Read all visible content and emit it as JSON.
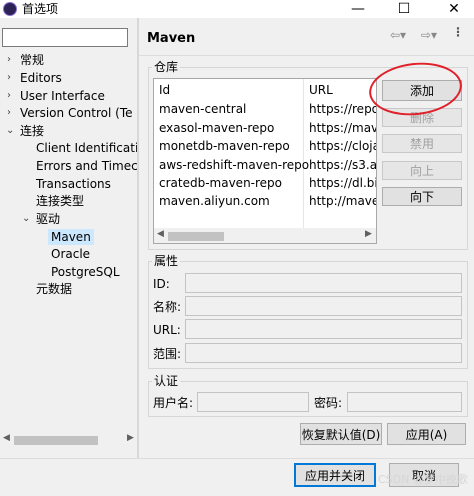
{
  "window": {
    "title": "首选项",
    "controls": {
      "minimize": "—",
      "maximize": "☐",
      "close": "✕"
    }
  },
  "sidebar": {
    "filter_value": "",
    "items": [
      {
        "label": "常规"
      },
      {
        "label": "Editors"
      },
      {
        "label": "User Interface"
      },
      {
        "label": "Version Control (Te"
      },
      {
        "label": "连接"
      },
      {
        "label": "Client Identificati"
      },
      {
        "label": "Errors and Timec"
      },
      {
        "label": "Transactions"
      },
      {
        "label": "连接类型"
      },
      {
        "label": "驱动"
      },
      {
        "label": "Maven"
      },
      {
        "label": "Oracle"
      },
      {
        "label": "PostgreSQL"
      },
      {
        "label": "元数据"
      }
    ]
  },
  "page": {
    "title": "Maven",
    "repositories": {
      "group_label": "仓库",
      "columns": [
        "Id",
        "URL"
      ],
      "rows": [
        [
          "maven-central",
          "https://repo"
        ],
        [
          "exasol-maven-repo",
          "https://mave"
        ],
        [
          "monetdb-maven-repo",
          "https://cloja"
        ],
        [
          "aws-redshift-maven-repo",
          "https://s3.ar"
        ],
        [
          "cratedb-maven-repo",
          "https://dl.bi"
        ],
        [
          "maven.aliyun.com",
          "http://mave"
        ]
      ],
      "buttons": {
        "add": "添加",
        "delete": "删除",
        "disable": "禁用",
        "up": "向上",
        "down": "向下"
      }
    },
    "properties": {
      "group_label": "属性",
      "id_label": "ID:",
      "name_label": "名称:",
      "url_label": "URL:",
      "scope_label": "范围:"
    },
    "auth": {
      "group_label": "认证",
      "user_label": "用户名:",
      "password_label": "密码:"
    },
    "restore_defaults": "恢复默认值(D)",
    "apply": "应用(A)"
  },
  "footer": {
    "apply_close": "应用并关闭",
    "cancel": "取消"
  },
  "watermark": "CSDN @梦中挽歌",
  "colors": {
    "annotation": "#e0202a",
    "selection": "#cce8ff",
    "primary_border": "#0078d7"
  }
}
